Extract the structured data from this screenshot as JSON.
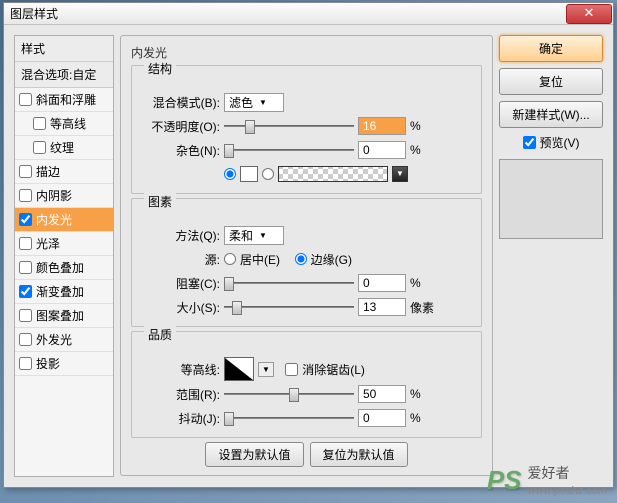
{
  "window": {
    "title": "图层样式"
  },
  "styles": {
    "header": "样式",
    "blendOptions": "混合选项:自定",
    "items": [
      {
        "label": "斜面和浮雕",
        "checked": false,
        "indent": false
      },
      {
        "label": "等高线",
        "checked": false,
        "indent": true
      },
      {
        "label": "纹理",
        "checked": false,
        "indent": true
      },
      {
        "label": "描边",
        "checked": false,
        "indent": false
      },
      {
        "label": "内阴影",
        "checked": false,
        "indent": false
      },
      {
        "label": "内发光",
        "checked": true,
        "indent": false,
        "selected": true
      },
      {
        "label": "光泽",
        "checked": false,
        "indent": false
      },
      {
        "label": "颜色叠加",
        "checked": false,
        "indent": false
      },
      {
        "label": "渐变叠加",
        "checked": true,
        "indent": false
      },
      {
        "label": "图案叠加",
        "checked": false,
        "indent": false
      },
      {
        "label": "外发光",
        "checked": false,
        "indent": false
      },
      {
        "label": "投影",
        "checked": false,
        "indent": false
      }
    ]
  },
  "panel": {
    "title": "内发光",
    "structure": {
      "title": "结构",
      "blendModeLabel": "混合模式(B):",
      "blendModeValue": "滤色",
      "opacityLabel": "不透明度(O):",
      "opacityValue": "16",
      "opacityUnit": "%",
      "noiseLabel": "杂色(N):",
      "noiseValue": "0",
      "noiseUnit": "%"
    },
    "elements": {
      "title": "图素",
      "methodLabel": "方法(Q):",
      "methodValue": "柔和",
      "sourceLabel": "源:",
      "sourceCenter": "居中(E)",
      "sourceEdge": "边缘(G)",
      "chokeLabel": "阻塞(C):",
      "chokeValue": "0",
      "chokeUnit": "%",
      "sizeLabel": "大小(S):",
      "sizeValue": "13",
      "sizeUnit": "像素"
    },
    "quality": {
      "title": "品质",
      "contourLabel": "等高线:",
      "antiAliasLabel": "消除锯齿(L)",
      "rangeLabel": "范围(R):",
      "rangeValue": "50",
      "rangeUnit": "%",
      "jitterLabel": "抖动(J):",
      "jitterValue": "0",
      "jitterUnit": "%"
    },
    "buttons": {
      "setDefault": "设置为默认值",
      "resetDefault": "复位为默认值"
    }
  },
  "right": {
    "ok": "确定",
    "cancel": "复位",
    "newStyle": "新建样式(W)...",
    "previewLabel": "预览(V)"
  },
  "watermark": {
    "ps": "PS",
    "cn": "爱好者",
    "url": "www.psahz.com"
  }
}
